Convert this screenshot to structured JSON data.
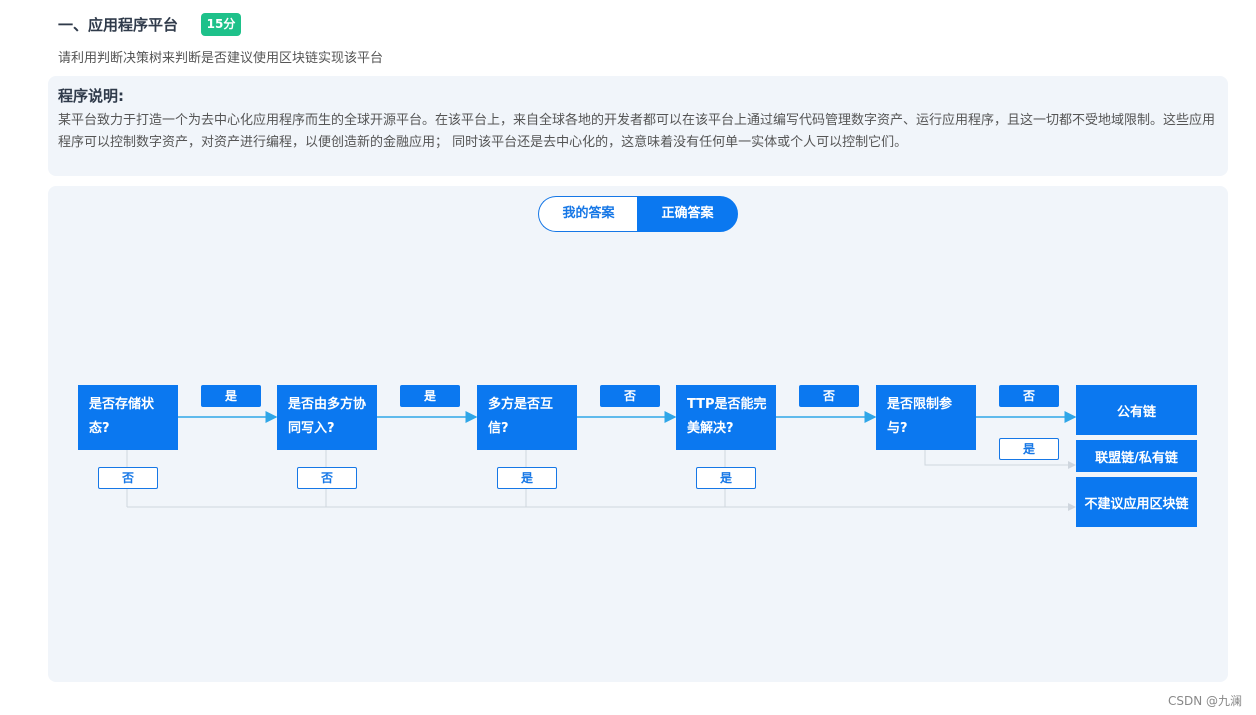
{
  "question": {
    "title": "一、应用程序平台",
    "score": "15分",
    "instruction": "请利用判断决策树来判断是否建议使用区块链实现该平台"
  },
  "description": {
    "title": "程序说明:",
    "body": "某平台致力于打造一个为去中心化应用程序而生的全球开源平台。在该平台上，来自全球各地的开发者都可以在该平台上通过编写代码管理数字资产、运行应用程序，且这一切都不受地域限制。这些应用程序可以控制数字资产，对资产进行编程，以便创造新的金融应用； 同时该平台还是去中心化的，这意味着没有任何单一实体或个人可以控制它们。"
  },
  "tabs": {
    "mine": "我的答案",
    "correct": "正确答案",
    "active": "correct"
  },
  "flow": {
    "nodes": [
      {
        "id": "q1",
        "label": "是否存储状态?"
      },
      {
        "id": "q2",
        "label": "是否由多方协同写入?"
      },
      {
        "id": "q3",
        "label": "多方是否互信?"
      },
      {
        "id": "q4",
        "label": "TTP是否能完美解决?"
      },
      {
        "id": "q5",
        "label": "是否限制参与?"
      }
    ],
    "forward_labels": [
      "是",
      "是",
      "否",
      "否",
      "否"
    ],
    "down_labels": [
      "否",
      "否",
      "是",
      "是"
    ],
    "q5_down_label": "是",
    "results": {
      "public": "公有链",
      "consortium": "联盟链/私有链",
      "none": "不建议应用区块链"
    }
  },
  "colors": {
    "primary": "#0b78f0",
    "score_badge": "#1ec18a",
    "panel_bg": "#f1f5fa",
    "connector": "#cfd6de",
    "arrow": "#2fa6e8"
  },
  "watermark": "CSDN @九澜"
}
